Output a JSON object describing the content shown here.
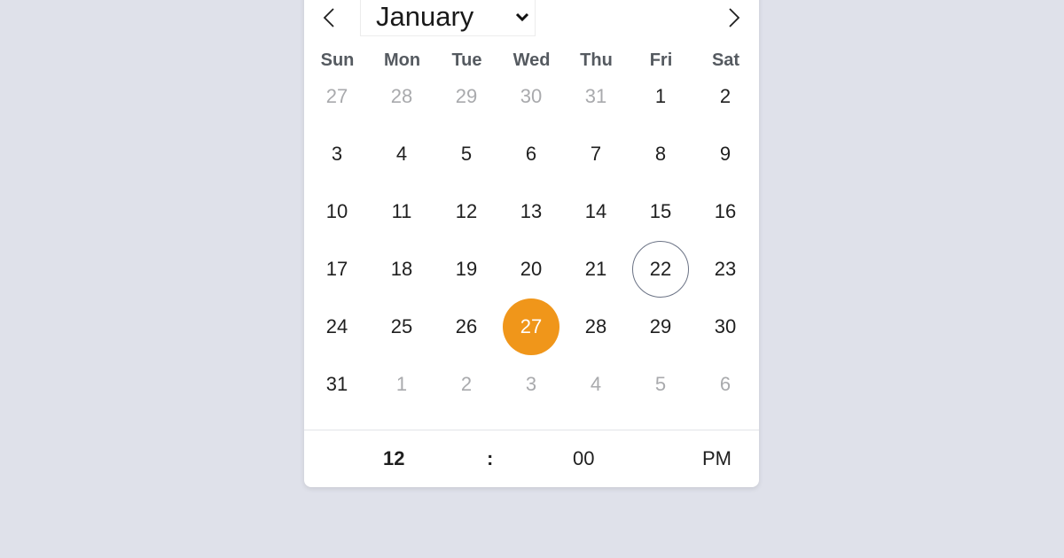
{
  "header": {
    "month": "January",
    "prev_icon": "chevron-left-icon",
    "next_icon": "chevron-right-icon",
    "dropdown_icon": "chevron-down-icon"
  },
  "weekdays": [
    "Sun",
    "Mon",
    "Tue",
    "Wed",
    "Thu",
    "Fri",
    "Sat"
  ],
  "weeks": [
    [
      {
        "d": "27",
        "m": true
      },
      {
        "d": "28",
        "m": true
      },
      {
        "d": "29",
        "m": true
      },
      {
        "d": "30",
        "m": true
      },
      {
        "d": "31",
        "m": true
      },
      {
        "d": "1"
      },
      {
        "d": "2"
      }
    ],
    [
      {
        "d": "3"
      },
      {
        "d": "4"
      },
      {
        "d": "5"
      },
      {
        "d": "6"
      },
      {
        "d": "7"
      },
      {
        "d": "8"
      },
      {
        "d": "9"
      }
    ],
    [
      {
        "d": "10"
      },
      {
        "d": "11"
      },
      {
        "d": "12"
      },
      {
        "d": "13"
      },
      {
        "d": "14"
      },
      {
        "d": "15"
      },
      {
        "d": "16"
      }
    ],
    [
      {
        "d": "17"
      },
      {
        "d": "18"
      },
      {
        "d": "19"
      },
      {
        "d": "20"
      },
      {
        "d": "21"
      },
      {
        "d": "22",
        "today": true
      },
      {
        "d": "23"
      }
    ],
    [
      {
        "d": "24"
      },
      {
        "d": "25"
      },
      {
        "d": "26"
      },
      {
        "d": "27",
        "selected": true
      },
      {
        "d": "28"
      },
      {
        "d": "29"
      },
      {
        "d": "30"
      }
    ],
    [
      {
        "d": "31"
      },
      {
        "d": "1",
        "m": true
      },
      {
        "d": "2",
        "m": true
      },
      {
        "d": "3",
        "m": true
      },
      {
        "d": "4",
        "m": true
      },
      {
        "d": "5",
        "m": true
      },
      {
        "d": "6",
        "m": true
      }
    ]
  ],
  "time": {
    "hour": "12",
    "separator": ":",
    "minute": "00",
    "period": "PM"
  },
  "colors": {
    "selected_bg": "#f0961a",
    "today_ring": "#6b7385",
    "muted_text": "#a9aaad",
    "page_bg": "#dfe1ea"
  }
}
